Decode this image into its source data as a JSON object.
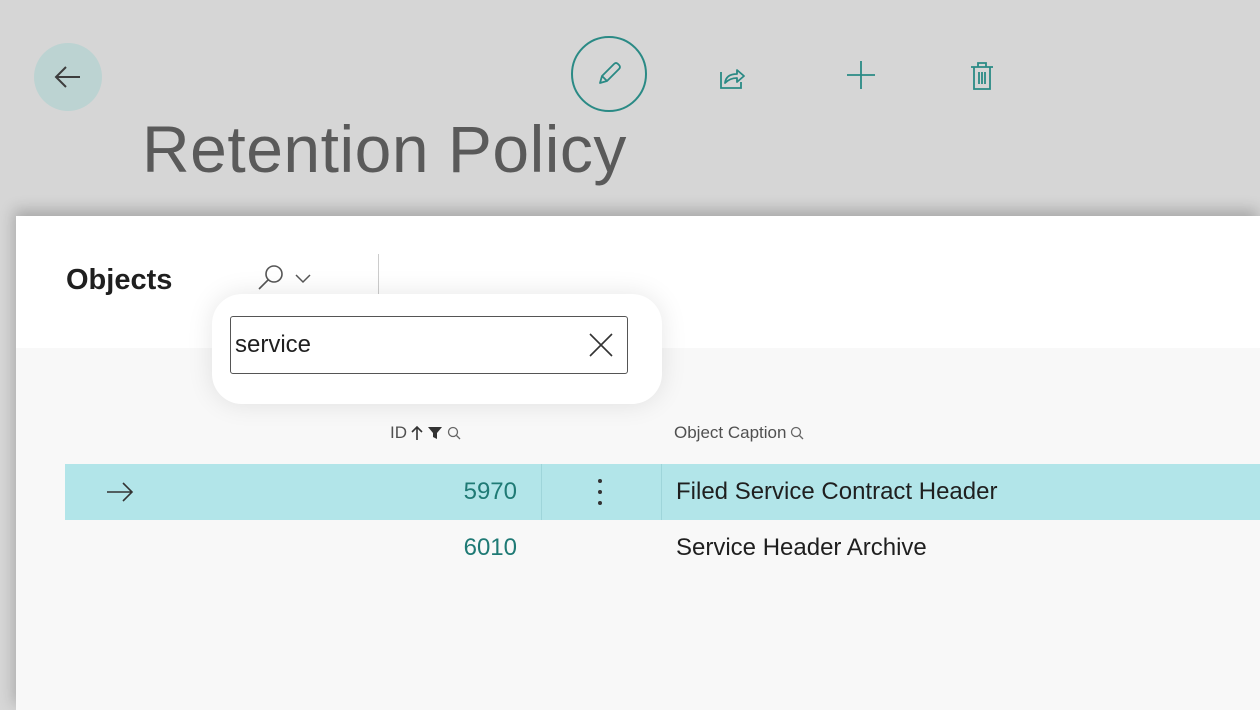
{
  "header": {
    "title": "Retention Policy",
    "icons": {
      "back": "arrow-left-icon",
      "edit": "pencil-icon",
      "share": "share-icon",
      "new": "plus-icon",
      "delete": "trash-icon"
    }
  },
  "part": {
    "title": "Objects",
    "search": {
      "value": "service",
      "icon": "search-icon",
      "toggle_icon": "chevron-down-icon"
    },
    "columns": [
      {
        "label": "ID",
        "sort": "ascending",
        "filtered": true
      },
      {
        "label": "Object Caption"
      }
    ],
    "rows": [
      {
        "id": "5970",
        "caption": "Filed Service Contract Header",
        "selected": true
      },
      {
        "id": "6010",
        "caption": "Service Header Archive",
        "selected": false
      }
    ]
  },
  "colors": {
    "accent": "#2a8a85",
    "selected_row": "#b2e5e9",
    "link": "#1f7a75"
  }
}
